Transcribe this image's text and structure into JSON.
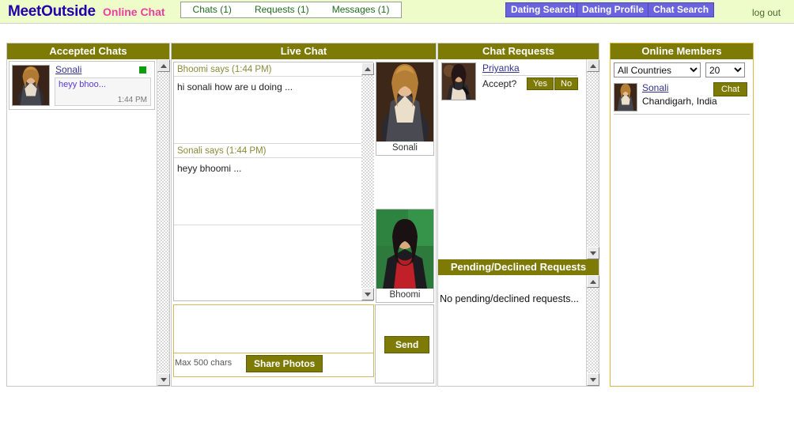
{
  "header": {
    "logo": "MeetOutside",
    "subtitle": "Online Chat",
    "tabs": [
      {
        "label": "Chats (1)"
      },
      {
        "label": "Requests (1)"
      },
      {
        "label": "Messages (1)"
      }
    ],
    "nav_buttons": [
      {
        "label": "Dating Search"
      },
      {
        "label": "Dating Profile"
      },
      {
        "label": "Chat Search"
      }
    ],
    "logout_label": "log out",
    "colors": {
      "header_bg": "#eefcc9",
      "logo_color": "#2200aa",
      "subtitle_color": "#e83fa0",
      "nav_button_bg": "#6b63dd",
      "panel_header_bg": "#7d7a06",
      "accent_gold": "#d8b63c",
      "online_dot": "#0c9f0c"
    }
  },
  "accepted_chats": {
    "title": "Accepted Chats",
    "entries": [
      {
        "name": "Sonali",
        "online": true,
        "preview": "heyy bhoo...",
        "time": "1:44 PM",
        "avatar": "woman-blonde-photo"
      }
    ]
  },
  "live_chat": {
    "title": "Live Chat",
    "messages": [
      {
        "header": "Bhoomi says (1:44 PM)",
        "body": "hi sonali how are u doing ..."
      },
      {
        "header": "Sonali says (1:44 PM)",
        "body": "heyy bhoomi ..."
      }
    ],
    "participants": [
      {
        "name": "Sonali",
        "avatar": "woman-blonde-photo"
      },
      {
        "name": "Bhoomi",
        "avatar": "woman-red-dress-photo"
      }
    ],
    "compose": {
      "value": "",
      "placeholder": "",
      "max_chars_label": "Max 500 chars",
      "share_photos_label": "Share Photos",
      "send_label": "Send"
    }
  },
  "chat_requests": {
    "title": "Chat Requests",
    "entries": [
      {
        "name": "Priyanka",
        "accept_label": "Accept?",
        "yes_label": "Yes",
        "no_label": "No",
        "avatar": "woman-dark-hair-photo"
      }
    ],
    "pending": {
      "title": "Pending/Declined Requests",
      "empty_text": "No pending/declined requests..."
    }
  },
  "online_members": {
    "title": "Online Members",
    "country_filter": {
      "selected": "All Countries",
      "options": [
        "All Countries"
      ]
    },
    "count_filter": {
      "selected": "20",
      "options": [
        "20"
      ]
    },
    "members": [
      {
        "name": "Sonali",
        "location": "Chandigarh, India",
        "chat_label": "Chat",
        "avatar": "woman-blonde-photo"
      }
    ]
  }
}
